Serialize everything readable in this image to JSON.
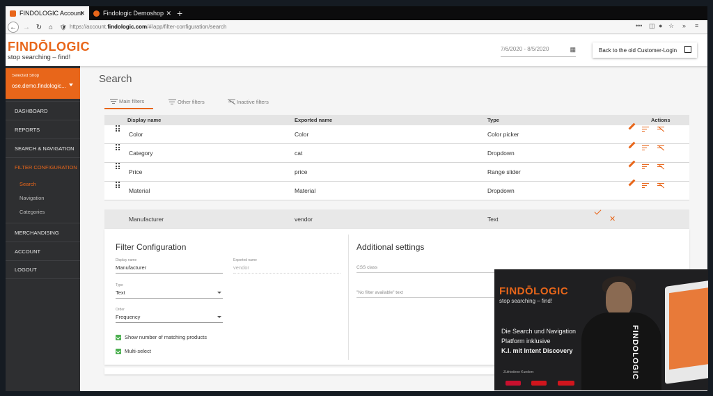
{
  "browser": {
    "tabs": [
      {
        "title": "FINDOLOGIC Account",
        "active": true
      },
      {
        "title": "Findologic Demoshop",
        "active": false
      }
    ],
    "new_tab": "+",
    "url_prefix": "https://account.",
    "url_domain": "findologic.com",
    "url_suffix": "/#/app/filter-configuration/search",
    "menu_dots": "•••"
  },
  "header": {
    "logo_word": "FINDŌLOGIC",
    "logo_tagline": "stop searching – find!",
    "date_range": "7/6/2020 - 8/5/2020",
    "old_login_button": "Back to the old Customer-Login"
  },
  "sidebar": {
    "selected_shop_label": "Selected Shop",
    "selected_shop_value": "ose.demo.findologic...",
    "items": [
      {
        "label": "DASHBOARD"
      },
      {
        "label": "REPORTS"
      },
      {
        "label": "SEARCH & NAVIGATION"
      },
      {
        "label": "FILTER CONFIGURATION"
      },
      {
        "label": "MERCHANDISING"
      },
      {
        "label": "ACCOUNT"
      },
      {
        "label": "LOGOUT"
      }
    ],
    "sub_items": [
      {
        "label": "Search"
      },
      {
        "label": "Navigation"
      },
      {
        "label": "Categories"
      }
    ]
  },
  "main": {
    "title": "Search",
    "filter_tabs": [
      "Main filters",
      "Other filters",
      "Inactive filters"
    ],
    "columns": [
      "Display name",
      "Exported name",
      "Type",
      "Actions"
    ],
    "rows": [
      {
        "display": "Color",
        "exported": "Color",
        "type": "Color picker"
      },
      {
        "display": "Category",
        "exported": "cat",
        "type": "Dropdown"
      },
      {
        "display": "Price",
        "exported": "price",
        "type": "Range slider"
      },
      {
        "display": "Material",
        "exported": "Material",
        "type": "Dropdown"
      }
    ],
    "edit_row": {
      "display": "Manufacturer",
      "exported": "vendor",
      "type": "Text"
    }
  },
  "config": {
    "title": "Filter Configuration",
    "display_name_label": "Display name",
    "display_name_value": "Manufacturer",
    "exported_name_label": "Exported name",
    "exported_name_value": "vendor",
    "type_label": "Type",
    "type_value": "Text",
    "order_label": "Order",
    "order_value": "Frequency",
    "checkbox_matching": "Show number of matching products",
    "checkbox_multiselect": "Multi-select",
    "additional_title": "Additional settings",
    "css_class_placeholder": "CSS class",
    "no_filter_placeholder": "\"No filter available\" text"
  },
  "video": {
    "logo_word": "FINDŌLOGIC",
    "tagline": "stop searching – find!",
    "line1": "Die Search und Navigation",
    "line2": "Platform inklusive",
    "line3": "K.I. mit Intent Discovery",
    "small": "Zufriedene Kunden:",
    "shirt": "FINDOLOGIC"
  },
  "colors": {
    "brand_orange": "#e8661a",
    "sidebar_bg": "#2e2f31",
    "check_green": "#4caf50"
  }
}
